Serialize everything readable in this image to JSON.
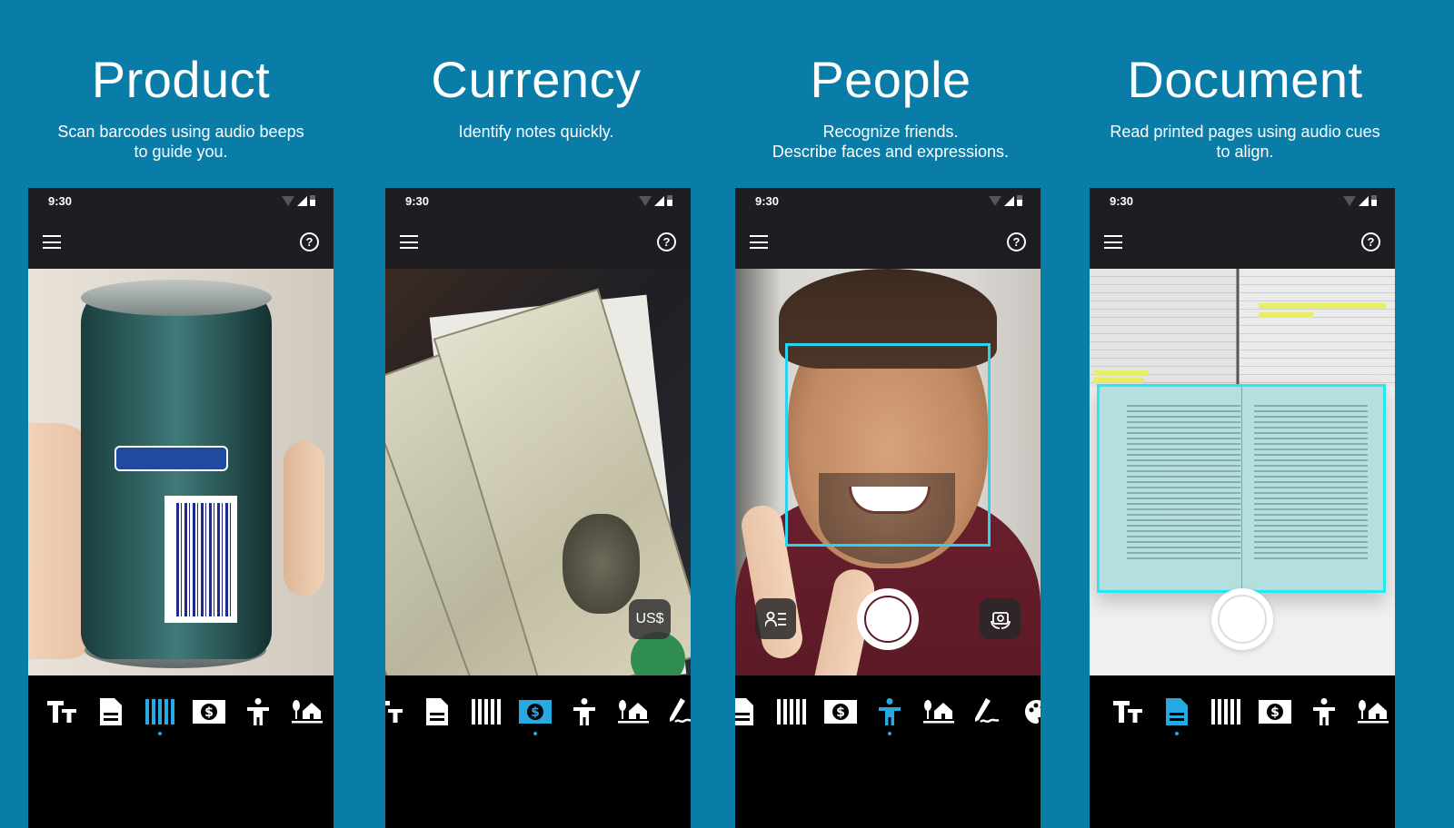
{
  "theme": {
    "background": "#0a7ca8",
    "accent": "#27a9e1",
    "frame_color": "#2ad4f0"
  },
  "panels": [
    {
      "title": "Product",
      "subtitle_lines": [
        "Scan barcodes using audio beeps",
        "to guide you."
      ],
      "status_time": "9:30",
      "active_tab": "product",
      "tabs": [
        "text",
        "document",
        "product",
        "currency",
        "people",
        "scene"
      ]
    },
    {
      "title": "Currency",
      "subtitle_lines": [
        "Identify notes quickly."
      ],
      "status_time": "9:30",
      "currency_badge": "US$",
      "active_tab": "currency",
      "tabs": [
        "text",
        "document",
        "product",
        "currency",
        "people",
        "scene",
        "handwriting"
      ]
    },
    {
      "title": "People",
      "subtitle_lines": [
        "Recognize friends.",
        "Describe faces and expressions."
      ],
      "status_time": "9:30",
      "active_tab": "people",
      "tabs": [
        "document",
        "product",
        "currency",
        "people",
        "scene",
        "handwriting",
        "color"
      ]
    },
    {
      "title": "Document",
      "subtitle_lines": [
        "Read printed pages using audio cues",
        "to align."
      ],
      "status_time": "9:30",
      "active_tab": "document",
      "tabs": [
        "text",
        "document",
        "product",
        "currency",
        "people",
        "scene"
      ]
    }
  ],
  "icons": {
    "menu": "menu-icon",
    "help": "help-circle-icon",
    "wifi": "wifi-icon",
    "signal": "signal-icon",
    "battery": "battery-icon",
    "people_list": "people-list-icon",
    "flip_camera": "flip-camera-icon"
  }
}
